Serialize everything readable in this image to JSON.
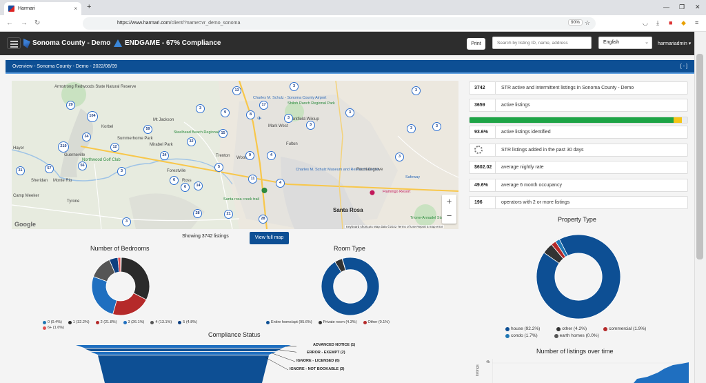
{
  "browser": {
    "tab_title": "Harmari",
    "tab_close": "×",
    "new_tab": "+",
    "url_host": "https://www.harmari.com",
    "url_path": "/client/?name=vr_demo_sonoma",
    "zoom": "90%"
  },
  "header": {
    "county_title": "Sonoma County - Demo",
    "endgame_title": "ENDGAME - 67% Compliance",
    "print_label": "Print",
    "search_placeholder": "Search by listing ID, name, address",
    "language": "English",
    "user": "harmariadmin"
  },
  "overview": {
    "breadcrumb": "Overview - Sonoma County - Demo - 2022/08/09",
    "collapse_label": "[ - ]"
  },
  "map": {
    "places": [
      "Armstrong Redwoods State Natural Reserve",
      "Mt Jackson",
      "Korbel",
      "Summerhome Park",
      "Mirabel Park",
      "Guerneville",
      "Northwood Golf Club",
      "Steelhead Beach Regional Park",
      "Forestville",
      "Trenton",
      "Woolsey",
      "Ross",
      "Monte Rio",
      "Sheridan",
      "Mark West",
      "Fulton",
      "Larkfield-Wikiup",
      "Shiloh Ranch Regional Park",
      "Charles M. Schulz - Sonoma County Airport",
      "Charles M. Schulz Museum and Research Center",
      "Flamingo Resort",
      "Safeway",
      "Santa Rosa",
      "Santa rosa creek trail",
      "Fountaingrove",
      "Trione-Annadel State Park",
      "Hayer",
      "Tyrone",
      "Camp Meeker"
    ],
    "clusters": [
      "29",
      "104",
      "34",
      "219",
      "57",
      "56",
      "31",
      "12",
      "59",
      "32",
      "24",
      "14",
      "6",
      "3",
      "5",
      "13",
      "17",
      "8",
      "9",
      "3",
      "15",
      "28",
      "21",
      "28",
      "6",
      "3",
      "9",
      "11",
      "3",
      "4",
      "4",
      "3",
      "3",
      "3",
      "3",
      "3",
      "3",
      "3"
    ],
    "google_label": "Google",
    "attribution": "Keyboard shortcuts   Map data ©2022   Terms of Use   Report a map error",
    "zoom_in": "+",
    "zoom_out": "−",
    "showing": "Showing 3742 listings",
    "view_full_map": "View full map"
  },
  "stats": [
    {
      "value": "3742",
      "label": "STR active and intermittent listings in Sonoma County - Demo"
    },
    {
      "value": "3659",
      "label": "active listings"
    },
    {
      "value": "93.6%",
      "label": "active listings identified"
    },
    {
      "value": "",
      "label": "STR listings added in the past 30 days"
    },
    {
      "value": "$602.02",
      "label": "average nightly rate"
    },
    {
      "value": "49.6%",
      "label": "average 6 month occupancy"
    },
    {
      "value": "196",
      "label": "operators with 2 or more listings"
    }
  ],
  "progress": {
    "identified": 0.936,
    "pending": 0.04,
    "colors": {
      "identified": "#1ea446",
      "pending": "#f5c518"
    }
  },
  "charts": {
    "bedrooms": {
      "title": "Number of Bedrooms",
      "type": "pie",
      "slices": [
        {
          "label": "0 (0.4%)",
          "value": 0.4,
          "color": "#1f77b4"
        },
        {
          "label": "1 (32.2%)",
          "value": 32.2,
          "color": "#2b2b2b"
        },
        {
          "label": "2 (21.8%)",
          "value": 21.8,
          "color": "#b52a2a"
        },
        {
          "label": "3 (26.1%)",
          "value": 26.1,
          "color": "#1f6fc0"
        },
        {
          "label": "4 (13.1%)",
          "value": 13.1,
          "color": "#555555"
        },
        {
          "label": "5 (4.8%)",
          "value": 4.8,
          "color": "#0d3f80"
        },
        {
          "label": "6+ (1.6%)",
          "value": 1.6,
          "color": "#e05050"
        }
      ]
    },
    "room_type": {
      "title": "Room Type",
      "type": "pie",
      "slices": [
        {
          "label": "Entire home/apt (95.6%)",
          "value": 95.6,
          "color": "#0d4f94"
        },
        {
          "label": "Private room (4.3%)",
          "value": 4.3,
          "color": "#333333"
        },
        {
          "label": "Other (0.1%)",
          "value": 0.1,
          "color": "#b52a2a"
        }
      ]
    },
    "property_type": {
      "title": "Property Type",
      "type": "pie",
      "slices": [
        {
          "label": "house (92.2%)",
          "value": 92.2,
          "color": "#0d4f94"
        },
        {
          "label": "other (4.2%)",
          "value": 4.2,
          "color": "#333333"
        },
        {
          "label": "commercial (1.9%)",
          "value": 1.9,
          "color": "#b52a2a"
        },
        {
          "label": "condo (1.7%)",
          "value": 1.7,
          "color": "#1f77b4"
        },
        {
          "label": "earth homes (0.0%)",
          "value": 0.0,
          "color": "#555555"
        }
      ]
    },
    "compliance": {
      "title": "Compliance Status",
      "labels": [
        "ADVANCED NOTICE (1)",
        "ERROR - EXEMPT (2)",
        "IGNORE - LICENSED (6)",
        "IGNORE - NOT BOOKABLE (3)"
      ]
    },
    "over_time": {
      "title": "Number of listings over time",
      "y_tick": "4k",
      "y_label": "listings"
    }
  }
}
